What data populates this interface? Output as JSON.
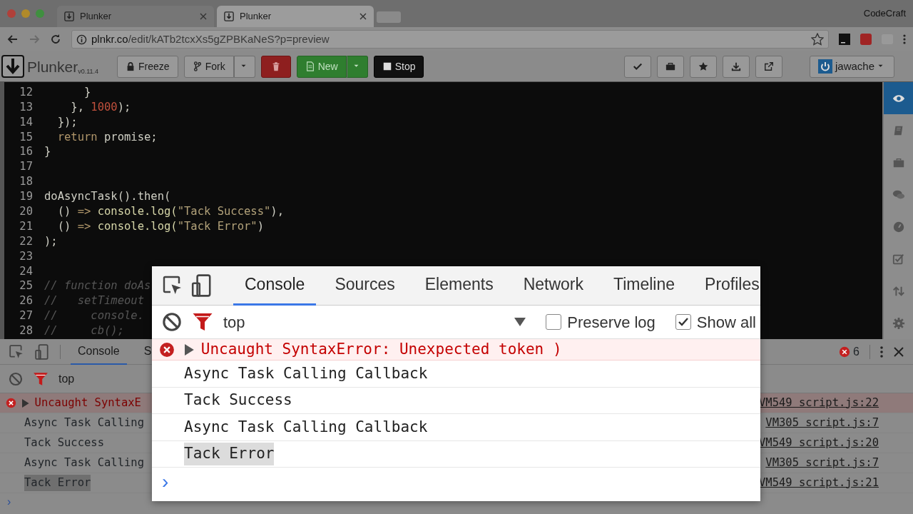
{
  "browser": {
    "tabs": [
      {
        "title": "Plunker",
        "selected": false
      },
      {
        "title": "Plunker",
        "selected": true
      }
    ],
    "profile": "CodeCraft",
    "url": {
      "host": "plnkr.co",
      "path": "/edit/kATb2tcxXs5gZPBKaNeS?p=preview"
    }
  },
  "toolbar": {
    "logo": "Plunker",
    "version": "v0.11.4",
    "buttons": [
      {
        "kind": "freeze",
        "label": "Freeze",
        "dropdown": false
      },
      {
        "kind": "fork",
        "label": "Fork",
        "dropdown": true
      },
      {
        "kind": "delete",
        "dropdown": false
      },
      {
        "kind": "new",
        "label": "New",
        "dropdown": true
      },
      {
        "kind": "stop",
        "label": "Stop",
        "dropdown": false
      }
    ],
    "actions": [
      {
        "kind": "check"
      },
      {
        "kind": "briefcase"
      },
      {
        "kind": "star"
      },
      {
        "kind": "download"
      },
      {
        "kind": "external"
      }
    ],
    "user": "jawache"
  },
  "editor": {
    "lines": [
      {
        "number": "12",
        "tokens": [
          {
            "kind": "plain",
            "text": "      }"
          }
        ]
      },
      {
        "number": "13",
        "tokens": [
          {
            "kind": "plain",
            "text": "    }, "
          },
          {
            "kind": "number",
            "text": "1000"
          },
          {
            "kind": "plain",
            "text": ");"
          }
        ]
      },
      {
        "number": "14",
        "tokens": [
          {
            "kind": "plain",
            "text": "  });"
          }
        ]
      },
      {
        "number": "15",
        "tokens": [
          {
            "kind": "keyword",
            "text": "  return"
          },
          {
            "kind": "plain",
            "text": " promise;"
          }
        ]
      },
      {
        "number": "16",
        "tokens": [
          {
            "kind": "plain",
            "text": "}"
          }
        ]
      },
      {
        "number": "17"
      },
      {
        "number": "18"
      },
      {
        "number": "19",
        "tokens": [
          {
            "kind": "plain",
            "text": "doAsyncTask().then("
          }
        ]
      },
      {
        "number": "20",
        "tokens": [
          {
            "kind": "plain",
            "text": "  () "
          },
          {
            "kind": "operator",
            "text": "=>"
          },
          {
            "kind": "call",
            "text": " console.log("
          },
          {
            "kind": "string",
            "text": "\"Tack Success\""
          },
          {
            "kind": "plain",
            "text": "),"
          }
        ]
      },
      {
        "number": "21",
        "tokens": [
          {
            "kind": "plain",
            "text": "  () "
          },
          {
            "kind": "operator",
            "text": "=>"
          },
          {
            "kind": "call",
            "text": " console.log("
          },
          {
            "kind": "string",
            "text": "\"Tack Error\""
          },
          {
            "kind": "plain",
            "text": ")"
          }
        ]
      },
      {
        "number": "22",
        "tokens": [
          {
            "kind": "plain",
            "text": ");"
          }
        ]
      },
      {
        "number": "23"
      },
      {
        "number": "24"
      },
      {
        "number": "25",
        "tokens": [
          {
            "kind": "comment",
            "text": "// function doAs"
          }
        ]
      },
      {
        "number": "26",
        "tokens": [
          {
            "kind": "comment",
            "text": "//   setTimeout"
          }
        ]
      },
      {
        "number": "27",
        "tokens": [
          {
            "kind": "comment",
            "text": "//     console."
          }
        ]
      },
      {
        "number": "28",
        "tokens": [
          {
            "kind": "comment",
            "text": "//     cb();"
          }
        ]
      }
    ]
  },
  "sidebar": {
    "items": [
      {
        "kind": "eye",
        "selected": true
      },
      {
        "kind": "book",
        "selected": false
      },
      {
        "kind": "briefcase",
        "selected": false
      },
      {
        "kind": "chat",
        "selected": false
      },
      {
        "kind": "gauge",
        "selected": false
      },
      {
        "kind": "tasks",
        "selected": false
      },
      {
        "kind": "sync",
        "selected": false
      },
      {
        "kind": "gear",
        "selected": false
      }
    ]
  },
  "devtools": {
    "tabs": [
      {
        "label": "Console",
        "selected": true
      },
      {
        "label": "S",
        "selected": false
      }
    ],
    "context": "top",
    "error_count": "6",
    "messages": [
      {
        "kind": "error",
        "text": "Uncaught SyntaxE",
        "source": "VM549 script.js:22",
        "highlighted": false
      },
      {
        "kind": "log",
        "text": "Async Task Calling",
        "source": "VM305 script.js:7",
        "highlighted": false
      },
      {
        "kind": "log",
        "text": "Tack Success",
        "source": "VM549 script.js:20",
        "highlighted": false
      },
      {
        "kind": "log",
        "text": "Async Task Calling",
        "source": "VM305 script.js:7",
        "highlighted": false
      },
      {
        "kind": "log",
        "text": "Tack Error",
        "source": "VM549 script.js:21",
        "highlighted": true
      }
    ],
    "prompt": "›"
  },
  "magnifier": {
    "tabs": [
      {
        "label": "Console",
        "selected": true
      },
      {
        "label": "Sources",
        "selected": false
      },
      {
        "label": "Elements",
        "selected": false
      },
      {
        "label": "Network",
        "selected": false
      },
      {
        "label": "Timeline",
        "selected": false
      },
      {
        "label": "Profiles",
        "selected": false
      }
    ],
    "context": "top",
    "options": [
      {
        "label": "Preserve log",
        "checked": false
      },
      {
        "label": "Show all",
        "checked": true
      }
    ],
    "messages": [
      {
        "kind": "error",
        "text": "Uncaught SyntaxError: Unexpected token )",
        "highlighted": false
      },
      {
        "kind": "log",
        "text": "Async Task Calling Callback",
        "highlighted": false
      },
      {
        "kind": "log",
        "text": "Tack Success",
        "highlighted": false
      },
      {
        "kind": "log",
        "text": "Async Task Calling Callback",
        "highlighted": false
      },
      {
        "kind": "log",
        "text": "Tack Error",
        "highlighted": true
      }
    ],
    "prompt": "›"
  }
}
